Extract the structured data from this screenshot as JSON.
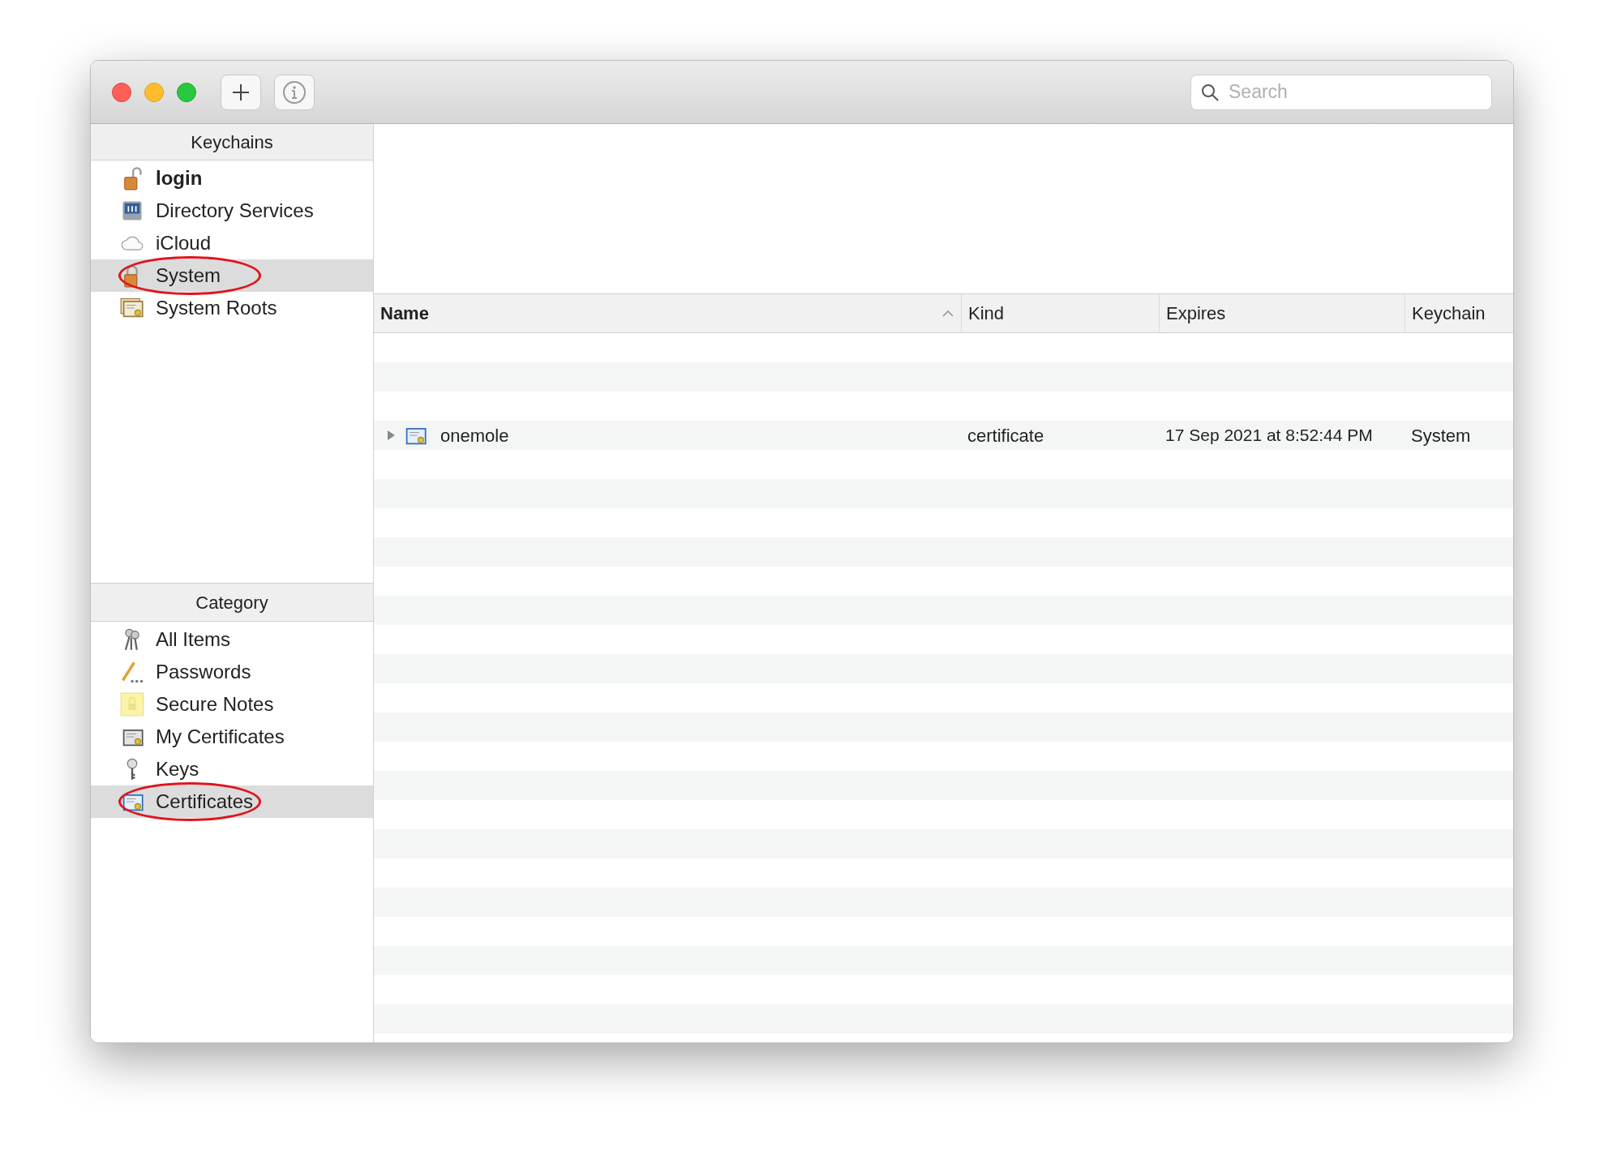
{
  "toolbar": {
    "search": {
      "placeholder": "Search"
    }
  },
  "keychains": {
    "title": "Keychains",
    "items": [
      {
        "label": "login",
        "kind": "openlock",
        "default": true,
        "selected": false,
        "circled": false
      },
      {
        "label": "Directory Services",
        "kind": "directory",
        "default": false,
        "selected": false,
        "circled": false
      },
      {
        "label": "iCloud",
        "kind": "cloud",
        "default": false,
        "selected": false,
        "circled": false
      },
      {
        "label": "System",
        "kind": "lock",
        "default": false,
        "selected": true,
        "circled": true
      },
      {
        "label": "System Roots",
        "kind": "certstack",
        "default": false,
        "selected": false,
        "circled": false
      }
    ]
  },
  "category": {
    "title": "Category",
    "items": [
      {
        "label": "All Items",
        "kind": "keys",
        "selected": false,
        "circled": false
      },
      {
        "label": "Passwords",
        "kind": "pencil",
        "selected": false,
        "circled": false
      },
      {
        "label": "Secure Notes",
        "kind": "note",
        "selected": false,
        "circled": false
      },
      {
        "label": "My Certificates",
        "kind": "mycert",
        "selected": false,
        "circled": false
      },
      {
        "label": "Keys",
        "kind": "key",
        "selected": false,
        "circled": false
      },
      {
        "label": "Certificates",
        "kind": "cert",
        "selected": true,
        "circled": true
      }
    ]
  },
  "table": {
    "columns": [
      {
        "label": "Name",
        "sorted": true
      },
      {
        "label": "Kind",
        "sorted": false
      },
      {
        "label": "Expires",
        "sorted": false
      },
      {
        "label": "Keychain",
        "sorted": false
      }
    ],
    "rows": [
      {
        "name": "onemole",
        "kind": "certificate",
        "expires": "17 Sep 2021 at 8:52:44 PM",
        "keychain": "System",
        "expanded": false
      }
    ]
  }
}
